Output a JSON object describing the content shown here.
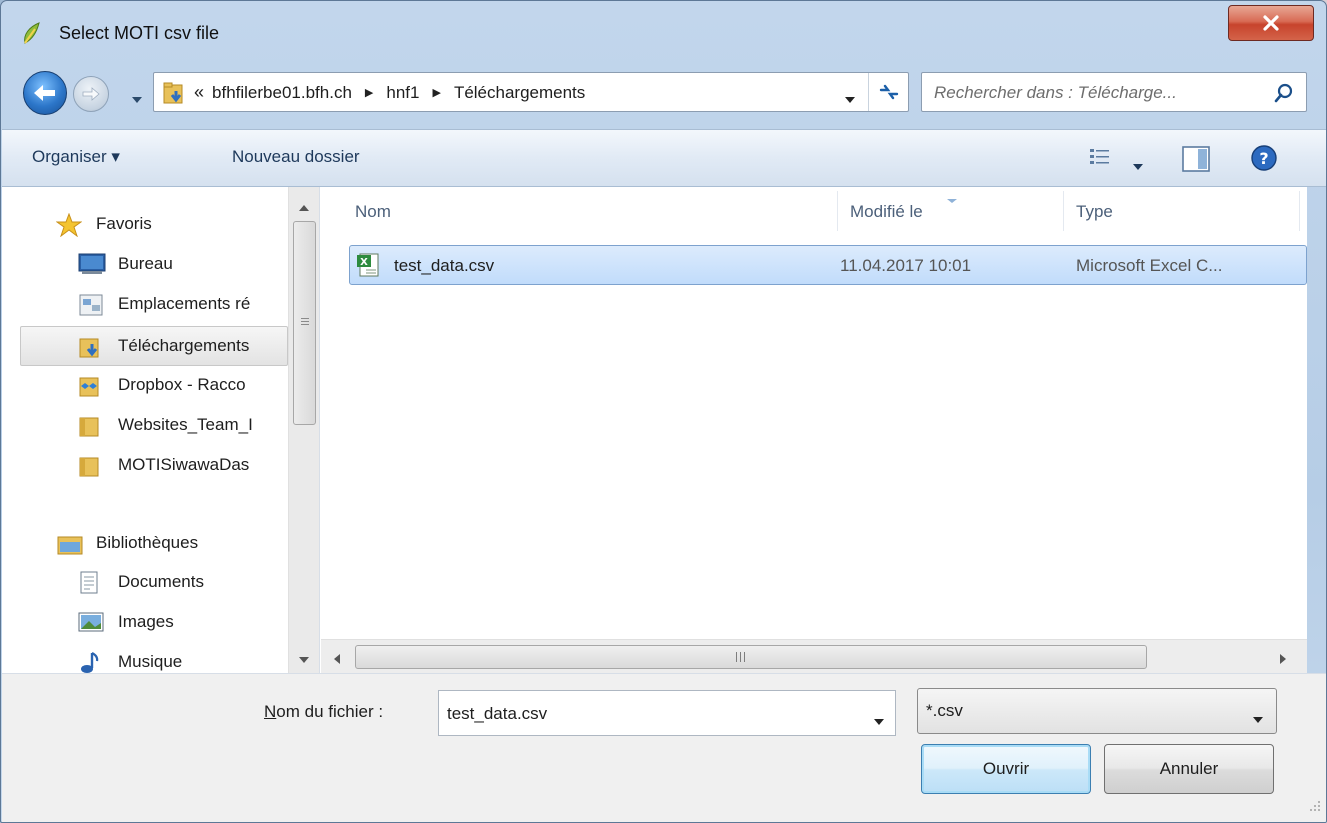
{
  "window": {
    "title": "Select MOTI csv file",
    "close_label": "X"
  },
  "address": {
    "overflow_chevrons": "«",
    "crumbs": [
      "bfhfilerbe01.bfh.ch",
      "hnf1",
      "Téléchargements"
    ],
    "search_placeholder": "Rechercher dans : Télécharge..."
  },
  "toolbar": {
    "organise_label": "Organiser ▾",
    "new_folder_label": "Nouveau dossier"
  },
  "nav": {
    "items": [
      {
        "label": "Favoris",
        "icon": "star-icon"
      },
      {
        "label": "Bureau",
        "icon": "desktop-icon"
      },
      {
        "label": "Emplacements ré",
        "icon": "network-places-icon"
      },
      {
        "label": "Téléchargements",
        "icon": "downloads-folder-icon"
      },
      {
        "label": "Dropbox - Racco",
        "icon": "dropbox-icon"
      },
      {
        "label": "Websites_Team_I",
        "icon": "folder-icon"
      },
      {
        "label": "MOTISiwawaDas",
        "icon": "folder-icon"
      },
      {
        "label": "Bibliothèques",
        "icon": "libraries-icon"
      },
      {
        "label": "Documents",
        "icon": "documents-icon"
      },
      {
        "label": "Images",
        "icon": "images-icon"
      },
      {
        "label": "Musique",
        "icon": "music-icon"
      }
    ]
  },
  "files": {
    "columns": [
      "Nom",
      "Modifié le",
      "Type"
    ],
    "rows": [
      {
        "name": "test_data.csv",
        "modified": "11.04.2017 10:01",
        "type": "Microsoft Excel C..."
      }
    ]
  },
  "scrollbar": {
    "h_grip": "III"
  },
  "bottom": {
    "filename_label_prefix": "N",
    "filename_label_rest": "om du fichier :",
    "filename_value": "test_data.csv",
    "filter_value": "*.csv",
    "open_label": "Ouvrir",
    "cancel_label": "Annuler"
  },
  "colors": {
    "accent": "#2c76c9",
    "selection": "#c1dcfb",
    "close": "#c7432c"
  }
}
